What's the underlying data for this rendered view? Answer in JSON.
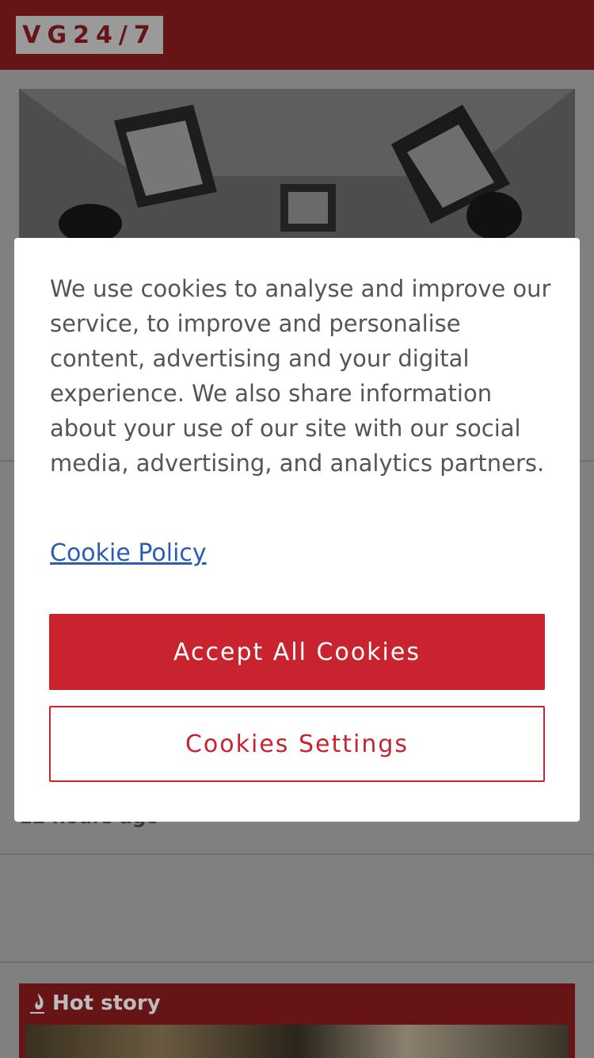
{
  "header": {
    "logo_text": "VG24/7"
  },
  "article": {
    "timestamp": "12 hours ago"
  },
  "hot_story": {
    "label": "Hot story",
    "icon": "flame-icon"
  },
  "cookie_dialog": {
    "message": "We use cookies to analyse and improve our service, to improve and personalise content, advertising and your digital experience. We also share information about your use of our site with our social media, advertising, and analytics partners.",
    "policy_link": "Cookie Policy",
    "accept_label": "Accept All Cookies",
    "settings_label": "Cookies Settings"
  },
  "colors": {
    "header_bg": "#661416",
    "accent": "#c8232e",
    "link": "#2b5db5"
  }
}
